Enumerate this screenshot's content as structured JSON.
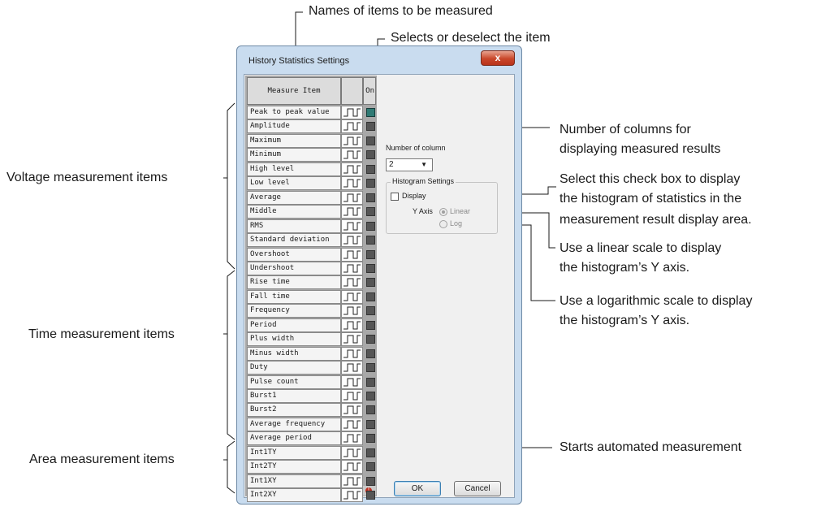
{
  "annotations": {
    "names_of_items": "Names of items to be measured",
    "selects_item": "Selects or deselect the item",
    "voltage_items": "Voltage measurement items",
    "time_items": "Time measurement items",
    "area_items": "Area measurement items",
    "num_columns_1": "Number of columns for",
    "num_columns_2": "displaying measured results",
    "checkbox_1": "Select this check box to display",
    "checkbox_2": "the histogram of statistics in the",
    "checkbox_3": "measurement result display area.",
    "linear_1": "Use a linear scale to display",
    "linear_2": "the histogram’s Y axis.",
    "log_1": "Use a logarithmic scale to display",
    "log_2": "the histogram’s Y axis.",
    "starts": "Starts automated measurement"
  },
  "dialog": {
    "title": "History Statistics Settings",
    "close_label": "x",
    "header_measure_item": "Measure Item",
    "header_on": "On",
    "items": [
      "Peak to peak value",
      "Amplitude",
      "Maximum",
      "Minimum",
      "High level",
      "Low level",
      "Average",
      "Middle",
      "RMS",
      "Standard deviation",
      "Overshoot",
      "Undershoot",
      "Rise time",
      "Fall time",
      "Frequency",
      "Period",
      "Plus width",
      "Minus width",
      "Duty",
      "Pulse count",
      "Burst1",
      "Burst2",
      "Average frequency",
      "Average period",
      "Int1TY",
      "Int2TY",
      "Int1XY",
      "Int2XY"
    ],
    "checked_index": 0,
    "number_of_column_label": "Number of column",
    "number_of_column_value": "2",
    "histogram_settings_label": "Histogram Settings",
    "display_label": "Display",
    "y_axis_label": "Y Axis",
    "linear_label": "Linear",
    "log_label": "Log",
    "ok_label": "OK",
    "cancel_label": "Cancel"
  },
  "colors": {
    "frame": "#c9dcef",
    "close_button": "#c9472a",
    "checkbox_on": "#2f7a74",
    "checkbox_off": "#555555"
  }
}
